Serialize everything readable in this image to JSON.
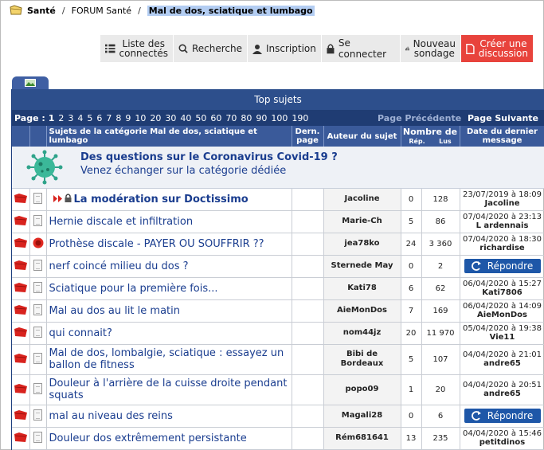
{
  "breadcrumb": {
    "home": "Santé",
    "forum": "FORUM Santé",
    "current": "Mal de dos, sciatique et lumbago"
  },
  "toolbar": {
    "list_connected_1": "Liste des",
    "list_connected_2": "connectés",
    "search": "Recherche",
    "register": "Inscription",
    "login": "Se connecter",
    "new_poll_1": "Nouveau",
    "new_poll_2": "sondage",
    "new_topic_1": "Créer une",
    "new_topic_2": "discussion"
  },
  "top_title": "Top sujets",
  "pager": {
    "label": "Page :",
    "pages": [
      "1",
      "2",
      "3",
      "4",
      "5",
      "6",
      "7",
      "8",
      "9",
      "10",
      "20",
      "30",
      "40",
      "50",
      "60",
      "70",
      "80",
      "90",
      "100",
      "190"
    ],
    "prev": "Page Précédente",
    "next": "Page Suivante"
  },
  "headers": {
    "subjects": "Sujets de la catégorie Mal de dos, sciatique et lumbago",
    "last_page_1": "Dern.",
    "last_page_2": "page",
    "author": "Auteur du sujet",
    "count_1": "Nombre de",
    "rep": "Rép.",
    "lus": "Lus",
    "date_1": "Date du dernier",
    "date_2": "message"
  },
  "promo": {
    "title": "Des questions sur le Coronavirus Covid-19 ?",
    "subtitle": "Venez échanger sur la catégorie dédiée"
  },
  "reply_label": "Répondre",
  "rows": [
    {
      "subject": "La modération sur Doctissimo",
      "author": "Jacoline",
      "rep": "0",
      "lus": "128",
      "date": "23/07/2019 à 18:09",
      "user": "Jacoline"
    },
    {
      "subject": "Hernie discale et infiltration",
      "author": "Marie-Ch",
      "rep": "5",
      "lus": "86",
      "date": "07/04/2020 à 23:13",
      "user": "L ardennais"
    },
    {
      "subject": "Prothèse discale - PAYER OU SOUFFRIR ??",
      "author": "jea78ko",
      "rep": "24",
      "lus": "3 360",
      "date": "07/04/2020 à 18:30",
      "user": "richardise"
    },
    {
      "subject": "nerf coincé milieu du dos ?",
      "author": "Sternede May",
      "rep": "0",
      "lus": "2",
      "date": "",
      "user": ""
    },
    {
      "subject": "Sciatique pour la première fois...",
      "author": "Kati78",
      "rep": "6",
      "lus": "62",
      "date": "06/04/2020 à 15:27",
      "user": "Kati7806"
    },
    {
      "subject": "Mal au dos au lit le matin",
      "author": "AieMonDos",
      "rep": "7",
      "lus": "169",
      "date": "06/04/2020 à 14:09",
      "user": "AieMonDos"
    },
    {
      "subject": "qui connait?",
      "author": "nom44jz",
      "rep": "20",
      "lus": "11 970",
      "date": "05/04/2020 à 19:38",
      "user": "Vie11"
    },
    {
      "subject": "Mal de dos, lombalgie, sciatique : essayez un ballon de fitness",
      "author": "Bibi de Bordeaux",
      "rep": "5",
      "lus": "107",
      "date": "04/04/2020 à 21:01",
      "user": "andre65"
    },
    {
      "subject": "Douleur à l'arrière de la cuisse droite pendant squats",
      "author": "popo09",
      "rep": "1",
      "lus": "20",
      "date": "04/04/2020 à 20:51",
      "user": "andre65"
    },
    {
      "subject": "mal au niveau des reins",
      "author": "Magali28",
      "rep": "0",
      "lus": "6",
      "date": "",
      "user": ""
    },
    {
      "subject": "Douleur dos extrêmement persistante",
      "author": "Rém681641",
      "rep": "13",
      "lus": "235",
      "date": "04/04/2020 à 15:46",
      "user": "petitdinos"
    }
  ]
}
